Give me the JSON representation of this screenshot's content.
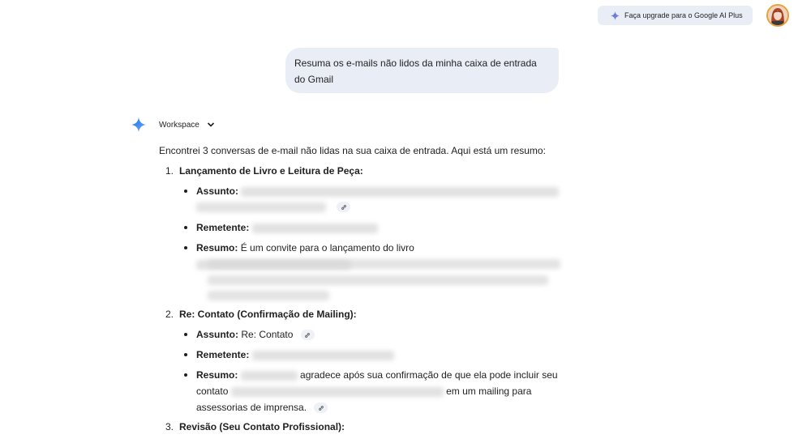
{
  "header": {
    "upgrade_label": "Faça upgrade para o Google AI Plus"
  },
  "user_message": "Resuma os e-mails não lidos da minha caixa de entrada do Gmail",
  "assistant": {
    "source_label": "Workspace",
    "intro": "Encontrei 3 conversas de e-mail não lidas na sua caixa de entrada. Aqui está um resumo:",
    "items": [
      {
        "number": "1.",
        "title": "Lançamento de Livro e Leitura de Peça:",
        "assunto_label": "Assunto:",
        "remetente_label": "Remetente:",
        "resumo_label": "Resumo:",
        "resumo_text": "É um convite para o lançamento do livro"
      },
      {
        "number": "2.",
        "title": "Re: Contato (Confirmação de Mailing):",
        "assunto_label": "Assunto:",
        "assunto_value": "Re: Contato",
        "remetente_label": "Remetente:",
        "resumo_label": "Resumo:",
        "resumo_text_1": "agradece após sua confirmação de que ela pode incluir seu",
        "resumo_text_2a": "contato",
        "resumo_text_2b": "em um mailing para",
        "resumo_text_3": "assessorias de imprensa."
      },
      {
        "number": "3.",
        "title": "Revisão (Seu Contato Profissional):"
      }
    ]
  },
  "colors": {
    "chip_bg": "#e9eef6",
    "gemini_blue": "#4285f4",
    "text": "#1f1f1f"
  },
  "icons": [
    "sparkle-icon",
    "avatar",
    "gemini-logo-icon",
    "chevron-down-icon",
    "link-icon"
  ]
}
